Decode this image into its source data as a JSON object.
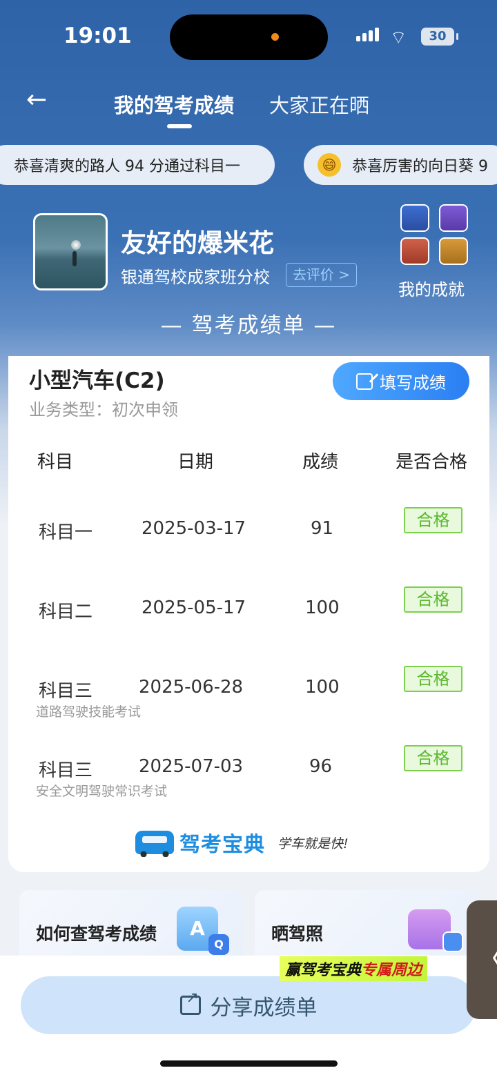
{
  "status": {
    "time": "19:01",
    "battery": "30"
  },
  "nav": {
    "tab_active": "我的驾考成绩",
    "tab_other": "大家正在晒"
  },
  "ticker": {
    "items": [
      "恭喜清爽的路人 94 分通过科目一",
      "恭喜厉害的向日葵 9"
    ],
    "emoji": "😄"
  },
  "profile": {
    "nickname": "友好的爆米花",
    "school": "银通驾校成家班分校",
    "review_label": "去评价 >",
    "achievement_label": "我的成就"
  },
  "section_title": "— 驾考成绩单 —",
  "card": {
    "car_type": "小型汽车(C2)",
    "business_type": "业务类型：初次申领",
    "fill_button": "填写成绩",
    "headers": [
      "科目",
      "日期",
      "成绩",
      "是否合格"
    ],
    "rows": [
      {
        "subject": "科目一",
        "date": "2025-03-17",
        "score": "91",
        "status": "合格",
        "note": ""
      },
      {
        "subject": "科目二",
        "date": "2025-05-17",
        "score": "100",
        "status": "合格",
        "note": ""
      },
      {
        "subject": "科目三",
        "date": "2025-06-28",
        "score": "100",
        "status": "合格",
        "note": "道路驾驶技能考试"
      },
      {
        "subject": "科目三",
        "date": "2025-07-03",
        "score": "96",
        "status": "合格",
        "note": "安全文明驾驶常识考试"
      }
    ],
    "brand": "驾考宝典",
    "slogan": "学车就是快!"
  },
  "tiles": {
    "query_label": "如何查驾考成绩",
    "license_label": "晒驾照"
  },
  "promo": {
    "part1": "赢驾考宝典",
    "part2": "专属周边"
  },
  "side_tab": "〈",
  "share_button": "分享成绩单"
}
